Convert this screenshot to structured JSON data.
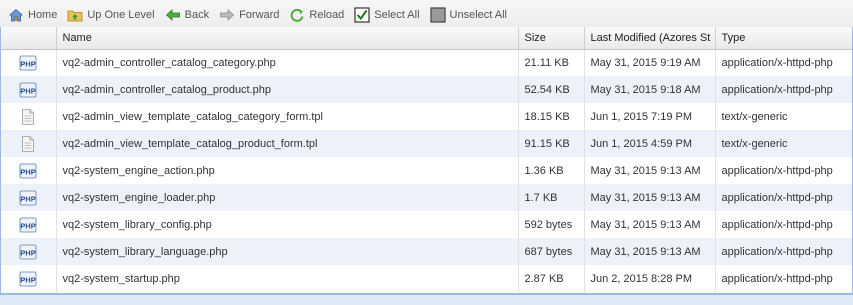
{
  "toolbar": {
    "home": "Home",
    "up": "Up One Level",
    "back": "Back",
    "forward": "Forward",
    "reload": "Reload",
    "select_all": "Select All",
    "unselect_all": "Unselect All"
  },
  "columns": {
    "name": "Name",
    "size": "Size",
    "modified": "Last Modified (Azores St",
    "type": "Type"
  },
  "files": [
    {
      "icon": "php-file-icon",
      "name": "vq2-admin_controller_catalog_category.php",
      "size": "21.11 KB",
      "modified": "May 31, 2015 9:19 AM",
      "type": "application/x-httpd-php"
    },
    {
      "icon": "php-file-icon",
      "name": "vq2-admin_controller_catalog_product.php",
      "size": "52.54 KB",
      "modified": "May 31, 2015 9:18 AM",
      "type": "application/x-httpd-php"
    },
    {
      "icon": "text-file-icon",
      "name": "vq2-admin_view_template_catalog_category_form.tpl",
      "size": "18.15 KB",
      "modified": "Jun 1, 2015 7:19 PM",
      "type": "text/x-generic"
    },
    {
      "icon": "text-file-icon",
      "name": "vq2-admin_view_template_catalog_product_form.tpl",
      "size": "91.15 KB",
      "modified": "Jun 1, 2015 4:59 PM",
      "type": "text/x-generic"
    },
    {
      "icon": "php-file-icon",
      "name": "vq2-system_engine_action.php",
      "size": "1.36 KB",
      "modified": "May 31, 2015 9:13 AM",
      "type": "application/x-httpd-php"
    },
    {
      "icon": "php-file-icon",
      "name": "vq2-system_engine_loader.php",
      "size": "1.7 KB",
      "modified": "May 31, 2015 9:13 AM",
      "type": "application/x-httpd-php"
    },
    {
      "icon": "php-file-icon",
      "name": "vq2-system_library_config.php",
      "size": "592 bytes",
      "modified": "May 31, 2015 9:13 AM",
      "type": "application/x-httpd-php"
    },
    {
      "icon": "php-file-icon",
      "name": "vq2-system_library_language.php",
      "size": "687 bytes",
      "modified": "May 31, 2015 9:13 AM",
      "type": "application/x-httpd-php"
    },
    {
      "icon": "php-file-icon",
      "name": "vq2-system_startup.php",
      "size": "2.87 KB",
      "modified": "Jun 2, 2015 8:28 PM",
      "type": "application/x-httpd-php"
    }
  ],
  "icon_labels": {
    "php": "PHP"
  }
}
